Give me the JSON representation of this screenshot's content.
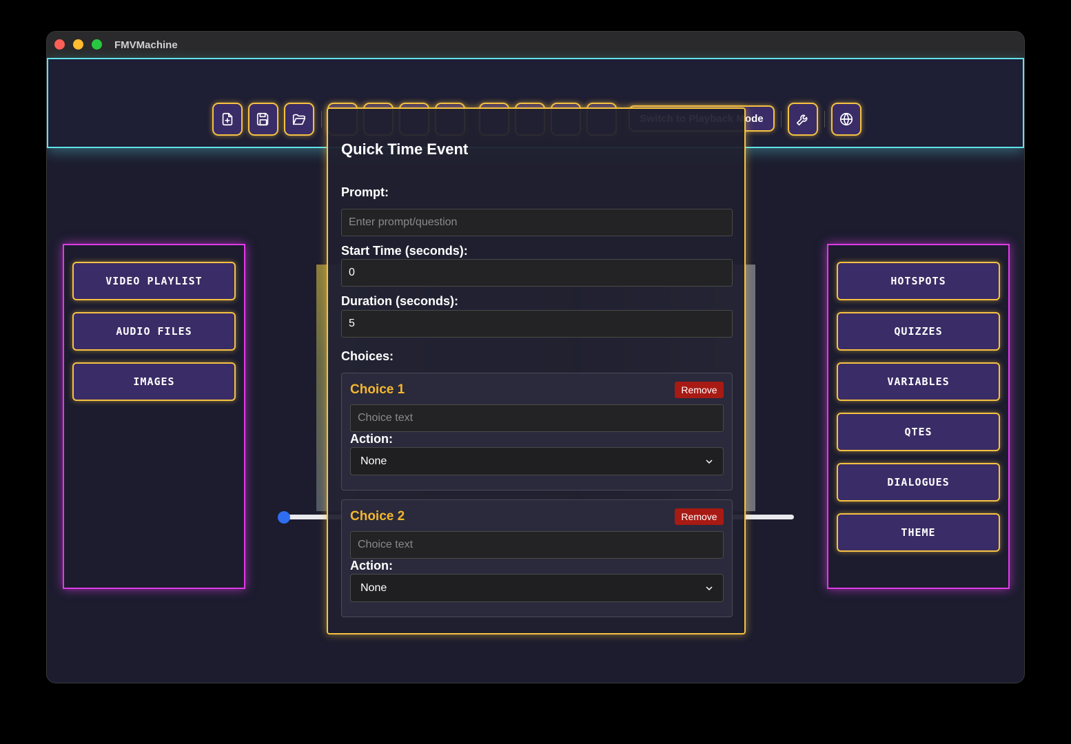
{
  "window": {
    "title": "FMVMachine"
  },
  "toolbar": {
    "mode_button": "Switch to Playback Mode"
  },
  "left_panel": {
    "items": [
      "VIDEO PLAYLIST",
      "AUDIO FILES",
      "IMAGES"
    ]
  },
  "right_panel": {
    "items": [
      "HOTSPOTS",
      "QUIZZES",
      "VARIABLES",
      "QTES",
      "DIALOGUES",
      "THEME"
    ]
  },
  "modal": {
    "title": "Quick Time Event",
    "prompt_label": "Prompt:",
    "prompt_placeholder": "Enter prompt/question",
    "start_label": "Start Time (seconds):",
    "start_value": "0",
    "duration_label": "Duration (seconds):",
    "duration_value": "5",
    "choices_label": "Choices:",
    "choices": [
      {
        "title": "Choice 1",
        "remove": "Remove",
        "placeholder": "Choice text",
        "action_label": "Action:",
        "action": "None"
      },
      {
        "title": "Choice 2",
        "remove": "Remove",
        "placeholder": "Choice text",
        "action_label": "Action:",
        "action": "None"
      }
    ]
  },
  "colors": {
    "accent_cyan": "#5fe3ea",
    "accent_gold": "#f5c242",
    "accent_magenta": "#e13ae8",
    "button_fill": "#3a2c66",
    "remove_red": "#a81a14"
  },
  "icons": [
    "new-file-icon",
    "save-icon",
    "open-folder-icon",
    "video-icon",
    "music-icon",
    "image-icon",
    "download-icon",
    "pointer-icon",
    "clock-icon",
    "gauge-icon",
    "chat-icon",
    "wrench-icon",
    "globe-icon"
  ]
}
